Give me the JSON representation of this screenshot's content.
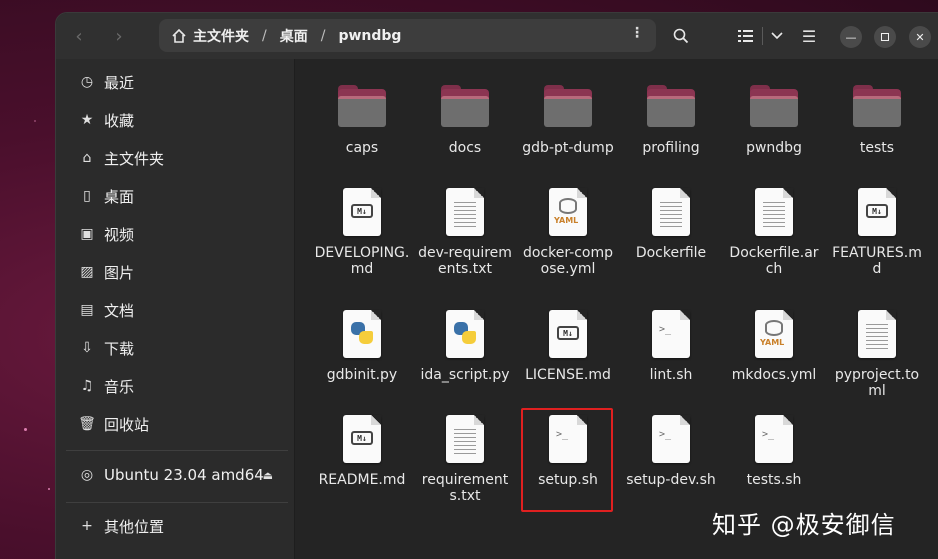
{
  "window": {
    "path": {
      "home": "主文件夹",
      "segment_1": "桌面",
      "segment_2": "pwndbg"
    }
  },
  "sidebar": {
    "items": [
      {
        "label": "最近",
        "icon": "clock-icon"
      },
      {
        "label": "收藏",
        "icon": "star-icon"
      },
      {
        "label": "主文件夹",
        "icon": "home-icon"
      },
      {
        "label": "桌面",
        "icon": "desktop-icon"
      },
      {
        "label": "视频",
        "icon": "film-icon"
      },
      {
        "label": "图片",
        "icon": "image-icon"
      },
      {
        "label": "文档",
        "icon": "document-icon"
      },
      {
        "label": "下载",
        "icon": "download-icon"
      },
      {
        "label": "音乐",
        "icon": "music-icon"
      },
      {
        "label": "回收站",
        "icon": "trash-icon"
      }
    ],
    "device": {
      "label": "Ubuntu 23.04 amd64",
      "icon": "disc-icon"
    },
    "other": {
      "label": "其他位置",
      "icon": "plus-icon"
    }
  },
  "files": [
    {
      "name": "caps",
      "kind": "folder"
    },
    {
      "name": "docs",
      "kind": "folder"
    },
    {
      "name": "gdb-pt-dump",
      "kind": "folder"
    },
    {
      "name": "profiling",
      "kind": "folder"
    },
    {
      "name": "pwndbg",
      "kind": "folder"
    },
    {
      "name": "tests",
      "kind": "folder"
    },
    {
      "name": "DEVELOPING.md",
      "kind": "markdown"
    },
    {
      "name": "dev-requirements.txt",
      "kind": "text"
    },
    {
      "name": "docker-compose.yml",
      "kind": "yaml"
    },
    {
      "name": "Dockerfile",
      "kind": "text"
    },
    {
      "name": "Dockerfile.arch",
      "kind": "text"
    },
    {
      "name": "FEATURES.md",
      "kind": "markdown"
    },
    {
      "name": "gdbinit.py",
      "kind": "python"
    },
    {
      "name": "ida_script.py",
      "kind": "python"
    },
    {
      "name": "LICENSE.md",
      "kind": "markdown"
    },
    {
      "name": "lint.sh",
      "kind": "shell"
    },
    {
      "name": "mkdocs.yml",
      "kind": "yaml"
    },
    {
      "name": "pyproject.toml",
      "kind": "text"
    },
    {
      "name": "README.md",
      "kind": "markdown"
    },
    {
      "name": "requirements.txt",
      "kind": "text"
    },
    {
      "name": "setup.sh",
      "kind": "shell",
      "highlighted": true
    },
    {
      "name": "setup-dev.sh",
      "kind": "shell"
    },
    {
      "name": "tests.sh",
      "kind": "shell"
    }
  ],
  "watermark": "知乎 @极安御信",
  "colors": {
    "highlight_border": "#e02020",
    "folder_accent": "#8c3552"
  }
}
